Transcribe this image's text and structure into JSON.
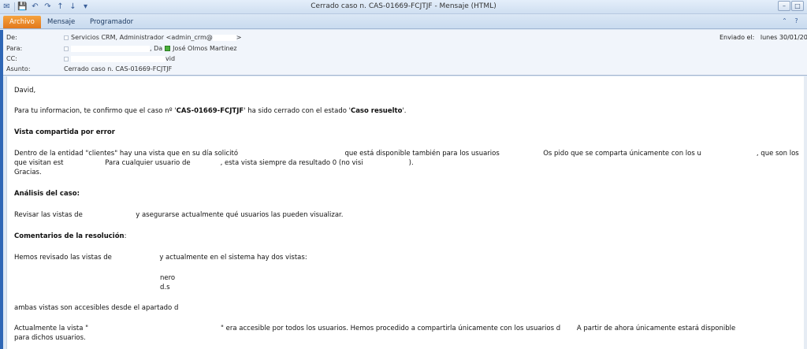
{
  "window": {
    "title": "Cerrado caso n. CAS-01669-FCJTJF  -  Mensaje (HTML)"
  },
  "ribbon": {
    "tabs": [
      "Archivo",
      "Mensaje",
      "Programador"
    ]
  },
  "header": {
    "from_label": "De:",
    "from_value": "Servicios CRM, Administrador <admin_crm@",
    "from_close": ">",
    "to_label": "Para:",
    "to_partial": ", Da",
    "to_contact": "José Olmos Martinez",
    "cc_label": "CC:",
    "cc_partial": "vid",
    "subject_label": "Asunto:",
    "subject_value": "Cerrado caso n. CAS-01669-FCJTJF",
    "sent_label": "Enviado el:",
    "sent_value": "lunes 30/01/20"
  },
  "body": {
    "greeting": "David,",
    "intro_prefix": "Para tu informacion, te confirmo que el caso nº '",
    "case_number": "CAS-01669-FCJTJF",
    "intro_middle": "' ha sido cerrado con el estado '",
    "case_status": "Caso resuelto",
    "intro_suffix": "'.",
    "h_vista": "Vista compartida por error",
    "vista_line1_a": "Dentro de la entidad \"clientes\" hay una vista que en su día solicitó",
    "vista_line1_b": "que está disponible también para los usuarios",
    "vista_line1_c": "Os pido que se comparta únicamente con los u",
    "vista_line1_d": ", que son los",
    "vista_line2_a": "que visitan est",
    "vista_line2_b": "Para cualquier usuario de",
    "vista_line2_c": ", esta vista siempre da resultado 0 (no visi",
    "vista_line2_d": ").",
    "vista_line3": "Gracias.",
    "h_analisis": "Análisis del caso:",
    "analisis_a": "Revisar las vistas de",
    "analisis_b": "y asegurarse actualmente qué usuarios las pueden visualizar.",
    "h_comentarios": "Comentarios de la resolución",
    "h_comentarios_colon": ":",
    "coment_a": "Hemos revisado las vistas de",
    "coment_b": "y actualmente en el sistema hay dos vistas:",
    "list1_end": "nero",
    "list2_end": "d.s",
    "ambas_a": "ambas vistas son accesibles desde el apartado d",
    "actual_a": "Actualmente la vista \"",
    "actual_b": "\" era accesible por todos los usuarios. Hemos procedido a compartirla únicamente con los usuarios d",
    "actual_c": "A partir de ahora únicamente estará disponible",
    "actual_line2": "para dichos usuarios."
  }
}
